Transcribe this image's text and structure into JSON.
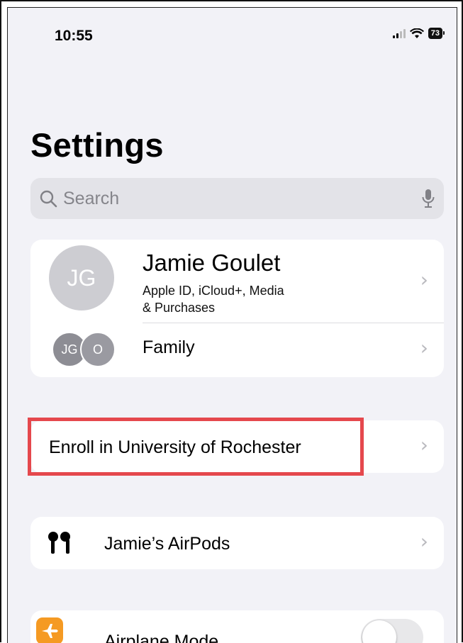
{
  "status_bar": {
    "time": "10:55",
    "battery": "73",
    "signal_icon": "cellular-signal-icon",
    "wifi_icon": "wifi-icon"
  },
  "page": {
    "title": "Settings"
  },
  "search": {
    "placeholder": "Search",
    "search_icon": "magnifier-icon",
    "mic_icon": "microphone-icon"
  },
  "profile": {
    "initials": "JG",
    "name": "Jamie Goulet",
    "subtitle_line1": "Apple ID, iCloud+, Media",
    "subtitle_line2": "& Purchases",
    "family_label": "Family",
    "family_members": [
      "JG",
      "O"
    ]
  },
  "enroll": {
    "label": "Enroll in University of Rochester"
  },
  "airpods": {
    "label": "Jamie’s AirPods",
    "icon": "airpods-icon"
  },
  "airplane": {
    "label": "Airplane Mode",
    "icon": "airplane-icon",
    "enabled": false
  },
  "colors": {
    "highlight": "#e5484d",
    "airplane_icon_bg": "#f59a23",
    "background": "#f2f2f7"
  }
}
